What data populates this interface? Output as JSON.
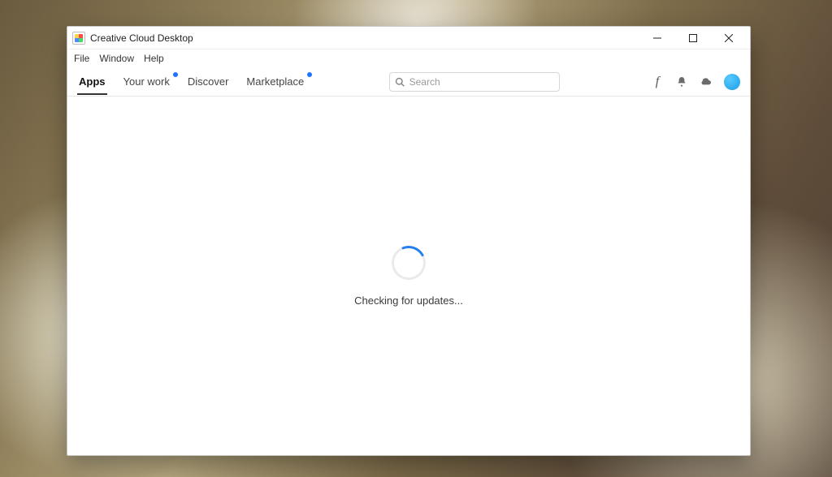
{
  "window": {
    "title": "Creative Cloud Desktop"
  },
  "menu": {
    "items": [
      "File",
      "Window",
      "Help"
    ]
  },
  "tabs": [
    {
      "label": "Apps",
      "active": true,
      "dot": false
    },
    {
      "label": "Your work",
      "active": false,
      "dot": true
    },
    {
      "label": "Discover",
      "active": false,
      "dot": false
    },
    {
      "label": "Marketplace",
      "active": false,
      "dot": true
    }
  ],
  "search": {
    "placeholder": "Search"
  },
  "icons": {
    "fonts": "fonts-icon",
    "notifications": "bell-icon",
    "cloud": "cloud-icon",
    "avatar": "avatar-icon"
  },
  "main": {
    "status": "Checking for updates..."
  }
}
